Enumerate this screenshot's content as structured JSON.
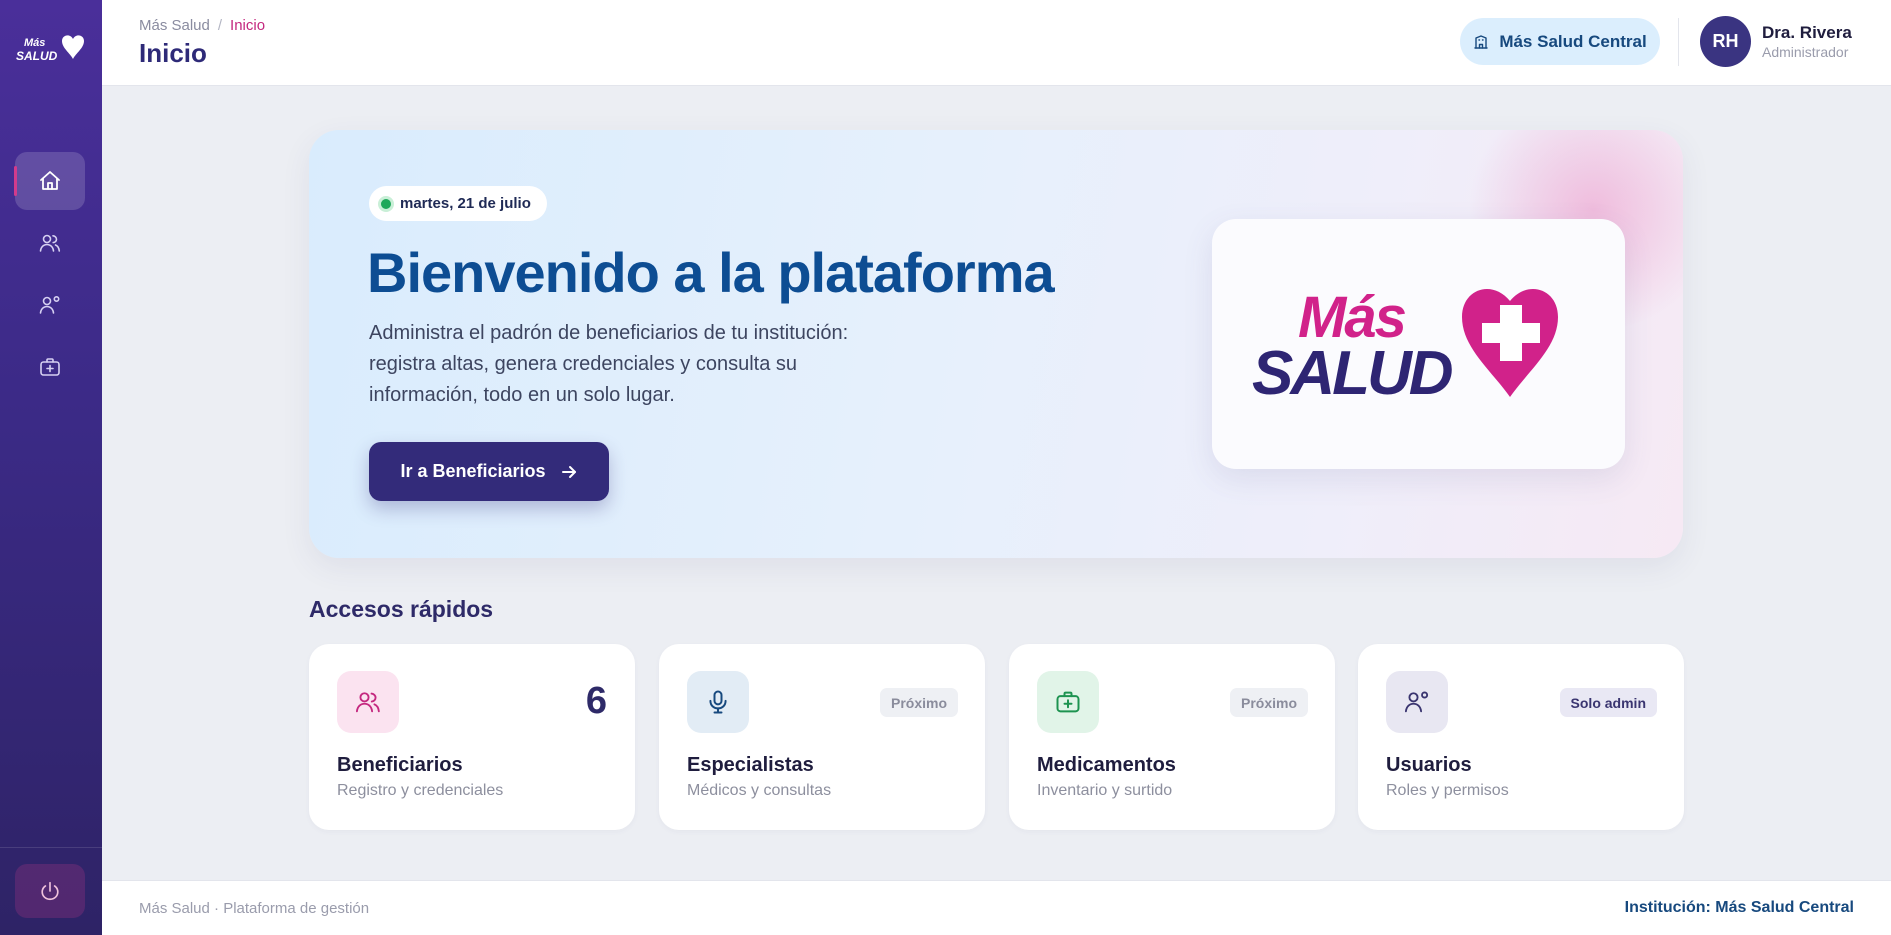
{
  "brand": {
    "logo_line1": "Más",
    "logo_line2": "SALUD",
    "colors": {
      "magenta": "#c4287f",
      "indigo": "#332b7a",
      "blue": "#0d4d93"
    }
  },
  "sidebar": {
    "items": [
      {
        "name": "home-icon",
        "active": true
      },
      {
        "name": "users-icon",
        "active": false
      },
      {
        "name": "user-settings-icon",
        "active": false
      },
      {
        "name": "medkit-icon",
        "active": false
      }
    ],
    "logout_icon": "power-icon"
  },
  "header": {
    "breadcrumb": {
      "root": "Más Salud",
      "separator": "/",
      "current": "Inicio"
    },
    "title": "Inicio",
    "institution_chip": "Más Salud Central",
    "user": {
      "initials": "RH",
      "name": "Dra. Rivera",
      "role": "Administrador"
    }
  },
  "hero": {
    "date": "martes, 21 de julio",
    "title": "Bienvenido a la plataforma",
    "description": "Administra el padrón de beneficiarios de tu institución: registra altas, genera credenciales y consulta su información, todo en un solo lugar.",
    "button_label": "Ir a Beneficiarios",
    "logo_line1": "Más",
    "logo_line2": "SALUD"
  },
  "quick_access": {
    "title": "Accesos rápidos",
    "cards": [
      {
        "title": "Beneficiarios",
        "subtitle": "Registro y credenciales",
        "count": "6",
        "icon": "users-icon"
      },
      {
        "title": "Especialistas",
        "subtitle": "Médicos y consultas",
        "badge": "Próximo",
        "icon": "microphone-icon"
      },
      {
        "title": "Medicamentos",
        "subtitle": "Inventario y surtido",
        "badge": "Próximo",
        "icon": "medkit-icon"
      },
      {
        "title": "Usuarios",
        "subtitle": "Roles y permisos",
        "badge": "Solo admin",
        "icon": "user-settings-icon"
      }
    ]
  },
  "footer": {
    "left": "Más Salud · Plataforma de gestión",
    "right": "Institución: Más Salud Central"
  }
}
